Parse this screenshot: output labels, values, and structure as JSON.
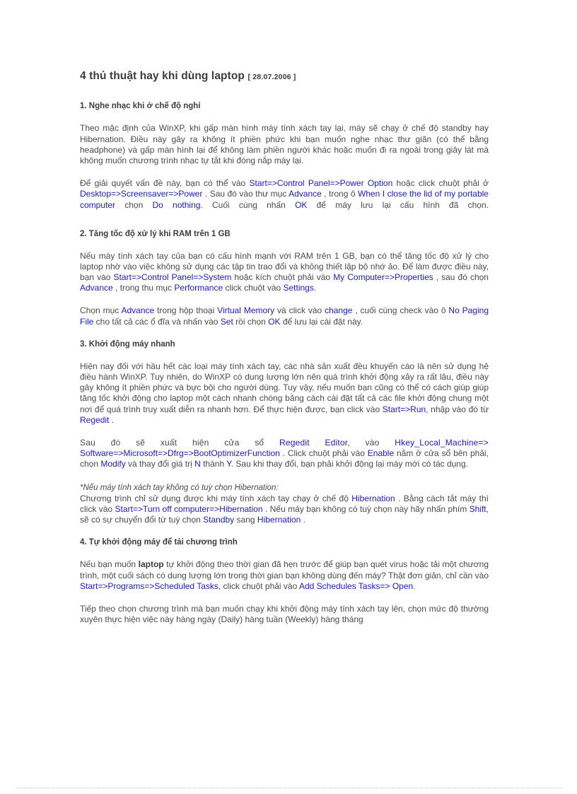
{
  "document": {
    "title": "4 thủ thuật hay khi dùng laptop",
    "date": "[ 28.07.2006 ]"
  },
  "sections": [
    {
      "heading": "1. Nghe nhạc khi ở chế độ nghỉ",
      "paragraphs": [
        {
          "id": "p1",
          "runs": [
            {
              "text": "Theo mặc định của WinXP, khi gấp màn hình máy tính xách tay lại, máy sẽ chạy ở chế độ standby hay Hibernation. Điều này gây ra không ít phiền phức khi bạn muốn nghe nhạc thư giãn (có thể bằng headphone) và gấp màn hình lại để không làm phiền người khác hoặc muốn đi ra ngoài trong giây lát mà không muốn chương trình nhạc tự tắt khi đóng nắp máy lại.",
              "style": "plain"
            }
          ]
        },
        {
          "id": "p2",
          "runs": [
            {
              "text": "Để giải quyết vấn đề này, bạn có thể vào ",
              "style": "plain"
            },
            {
              "text": "Start=>Control Panel=>Power Option",
              "style": "link"
            },
            {
              "text": " hoặc click chuột phải ở ",
              "style": "plain"
            },
            {
              "text": "Desktop=>Screensaver=>Power",
              "style": "link"
            },
            {
              "text": " . Sau đó vào thư mục ",
              "style": "plain"
            },
            {
              "text": "Advance",
              "style": "link"
            },
            {
              "text": " , trong ô ",
              "style": "plain"
            },
            {
              "text": "When I close the lid of my portable computer",
              "style": "link"
            },
            {
              "text": " chọn ",
              "style": "plain"
            },
            {
              "text": "Do nothing",
              "style": "link"
            },
            {
              "text": ". Cuối cùng nhấn ",
              "style": "plain"
            },
            {
              "text": "OK",
              "style": "link"
            },
            {
              "text": " để máy lưu lại cấu hình đã chọn.",
              "style": "plain"
            }
          ]
        }
      ]
    },
    {
      "heading": "2. Tăng tốc độ xử lý khi RAM trên 1 GB",
      "paragraphs": [
        {
          "id": "p3",
          "runs": [
            {
              "text": "Nếu máy tính xách tay của bạn có cấu hình mạnh với RAM trên 1 GB, bạn có thể tăng tốc độ xử lý cho laptop nhờ vào việc không sử dụng các tập tin trao đổi và không thiết lập bộ nhớ ảo. Để làm được điều này, bạn vào ",
              "style": "plain"
            },
            {
              "text": "Start=>Control Panel=>System",
              "style": "link"
            },
            {
              "text": " hoặc kích chuột phải vào ",
              "style": "plain"
            },
            {
              "text": "My Computer=>Properties",
              "style": "link"
            },
            {
              "text": " , sau đó chọn ",
              "style": "plain"
            },
            {
              "text": "Advance",
              "style": "link"
            },
            {
              "text": " , trong thu mục ",
              "style": "plain"
            },
            {
              "text": "Performance",
              "style": "link"
            },
            {
              "text": " click chuột vào ",
              "style": "plain"
            },
            {
              "text": "Settings",
              "style": "link"
            },
            {
              "text": ".",
              "style": "plain"
            }
          ]
        },
        {
          "id": "p4",
          "runs": [
            {
              "text": "Chọn mục ",
              "style": "plain"
            },
            {
              "text": "Advance",
              "style": "link"
            },
            {
              "text": " trong hộp thoại ",
              "style": "plain"
            },
            {
              "text": "Virtual Memory",
              "style": "link"
            },
            {
              "text": " và click vào ",
              "style": "plain"
            },
            {
              "text": "change",
              "style": "link"
            },
            {
              "text": " , cuối cùng check vào ô ",
              "style": "plain"
            },
            {
              "text": "No Paging File",
              "style": "link"
            },
            {
              "text": " cho tất cả các ổ đĩa và nhấn vào ",
              "style": "plain"
            },
            {
              "text": "Set",
              "style": "link"
            },
            {
              "text": " rồi chọn ",
              "style": "plain"
            },
            {
              "text": "OK",
              "style": "link"
            },
            {
              "text": " để lưu lại cài đặt này.",
              "style": "plain"
            }
          ]
        }
      ]
    },
    {
      "heading": "3. Khởi động máy nhanh",
      "paragraphs": [
        {
          "id": "p5",
          "runs": [
            {
              "text": "Hiện nay đối với hầu hết các loại máy tính xách tay, các nhà sản xuất đều khuyến cáo là nên sử dụng hệ điều hành WinXP. Tuy nhiên, do WinXP có dung lượng lớn nên quá trình khởi động xảy ra rất lâu, điều này gây không ít phiền phức và bực bội cho người dùng. Tuy vậy, nếu muốn bạn cũng có thể có cách giúp giúp tăng tốc khởi động cho laptop một cách nhanh chóng bằng cách cài đặt tất cả các file khởi động chung một nơi để quá trình truy xuất diễn ra nhanh hơn. Để thực hiện được, bạn click vào ",
              "style": "plain"
            },
            {
              "text": "Start=>Run",
              "style": "link"
            },
            {
              "text": ", nhập vào đó từ ",
              "style": "plain"
            },
            {
              "text": "Regedit",
              "style": "link"
            },
            {
              "text": " .",
              "style": "plain"
            }
          ]
        },
        {
          "id": "p6-line1",
          "runs": [
            {
              "text": "Sau đó sẽ xuất hiện cửa sổ ",
              "style": "plain"
            },
            {
              "text": "Regedit Editor",
              "style": "link"
            },
            {
              "text": ", vào ",
              "style": "plain"
            },
            {
              "text": "Hkey_Local_Machine=>",
              "style": "link"
            }
          ]
        },
        {
          "id": "p6-rest",
          "runs": [
            {
              "text": "Software=>Microsoft=>Dfrg=>BootOptimizerFunction",
              "style": "link"
            },
            {
              "text": " . Click chuột phải vào ",
              "style": "plain"
            },
            {
              "text": "Enable",
              "style": "link"
            },
            {
              "text": " nằm ở cửa sổ bên phải, chọn ",
              "style": "plain"
            },
            {
              "text": "Modify",
              "style": "link"
            },
            {
              "text": " và thay đổi giá trị ",
              "style": "plain"
            },
            {
              "text": "N",
              "style": "link"
            },
            {
              "text": " thành ",
              "style": "plain"
            },
            {
              "text": "Y",
              "style": "link"
            },
            {
              "text": ". Sau khi thay đổi, bạn phải khởi động lại máy mới có tác dụng.",
              "style": "plain"
            }
          ]
        },
        {
          "id": "p7-note-heading",
          "runs": [
            {
              "text": "*Nếu máy tính xách tay không có tuỳ chọn Hibernation:",
              "style": "italic"
            }
          ]
        },
        {
          "id": "p7",
          "runs": [
            {
              "text": "Chương trình chỉ sử dụng được khi máy tính xách tay chạy ở chế độ ",
              "style": "plain"
            },
            {
              "text": "Hibernation",
              "style": "link"
            },
            {
              "text": " . Bằng cách tắt máy thì click vào ",
              "style": "plain"
            },
            {
              "text": "Start=>Turn off computer=>Hibernation",
              "style": "link"
            },
            {
              "text": " . Nếu máy bạn không có tuỳ chọn này hãy nhấn phím ",
              "style": "plain"
            },
            {
              "text": "Shift",
              "style": "link"
            },
            {
              "text": ", sẽ có sự chuyển đổi từ tuỳ chọn ",
              "style": "plain"
            },
            {
              "text": "Standby",
              "style": "link"
            },
            {
              "text": " sang ",
              "style": "plain"
            },
            {
              "text": "Hibernation",
              "style": "link"
            },
            {
              "text": " .",
              "style": "plain"
            }
          ]
        }
      ]
    },
    {
      "heading": "4. Tự khởi động máy để tải chương trình",
      "paragraphs": [
        {
          "id": "p8",
          "runs": [
            {
              "text": "Nếu bạn muốn ",
              "style": "plain"
            },
            {
              "text": "laptop",
              "style": "bold"
            },
            {
              "text": " tự khởi động theo thời gian đã hẹn trước để giúp bạn quét virus hoặc tải một chương trình, một cuối sách có dung lượng lớn trong thời gian bạn không dùng đến máy? Thật đơn giản, chỉ cần vào ",
              "style": "plain"
            },
            {
              "text": "Start=>Programs=>Scheduled Tasks",
              "style": "link"
            },
            {
              "text": ", click chuột phải vào ",
              "style": "plain"
            },
            {
              "text": "Add Schedules Tasks=> Open",
              "style": "link"
            },
            {
              "text": ".",
              "style": "plain"
            }
          ]
        },
        {
          "id": "p9",
          "runs": [
            {
              "text": "Tiếp theo chọn chương trình mà bạn muốn chạy khi khởi động máy tính xách tay lên, chọn mức độ thường xuyên thực hiện việc này hàng ngày (Daily) hàng tuần (Weekly) hàng tháng",
              "style": "plain"
            }
          ]
        }
      ]
    }
  ],
  "colors": {
    "link": "#1a1ad6",
    "body_text": "#4a4a4a",
    "heading_text": "#3c3c3c",
    "rule": "#c9c9c9",
    "page_background": "#ffffff"
  }
}
